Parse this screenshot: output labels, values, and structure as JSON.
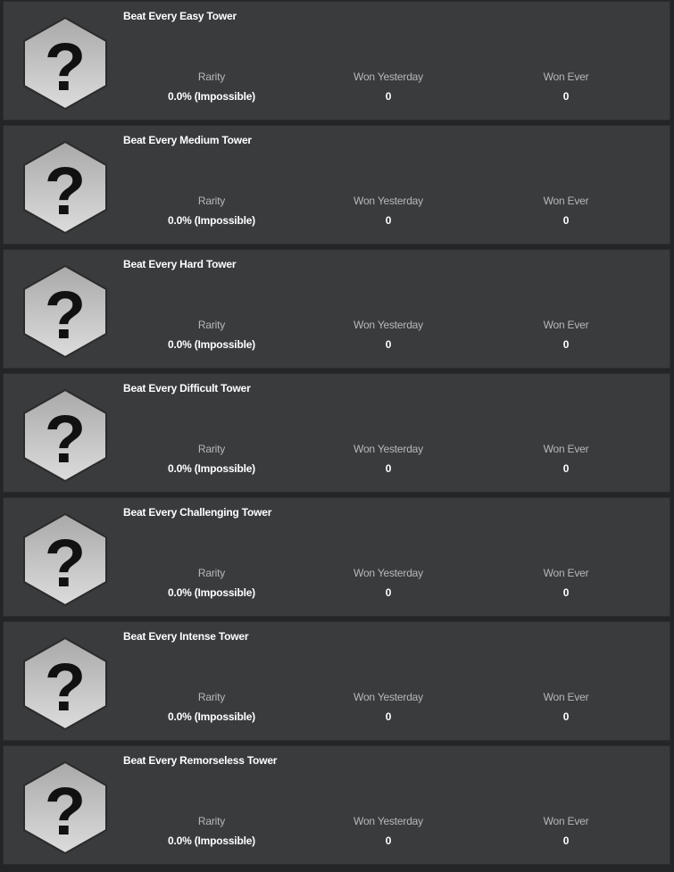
{
  "stat_labels": {
    "rarity": "Rarity",
    "won_yesterday": "Won Yesterday",
    "won_ever": "Won Ever"
  },
  "icon": "question-mark-hexagon-icon",
  "badges": [
    {
      "title": "Beat Every Easy Tower",
      "rarity": "0.0% (Impossible)",
      "won_yesterday": "0",
      "won_ever": "0"
    },
    {
      "title": "Beat Every Medium Tower",
      "rarity": "0.0% (Impossible)",
      "won_yesterday": "0",
      "won_ever": "0"
    },
    {
      "title": "Beat Every Hard Tower",
      "rarity": "0.0% (Impossible)",
      "won_yesterday": "0",
      "won_ever": "0"
    },
    {
      "title": "Beat Every Difficult Tower",
      "rarity": "0.0% (Impossible)",
      "won_yesterday": "0",
      "won_ever": "0"
    },
    {
      "title": "Beat Every Challenging Tower",
      "rarity": "0.0% (Impossible)",
      "won_yesterday": "0",
      "won_ever": "0"
    },
    {
      "title": "Beat Every Intense Tower",
      "rarity": "0.0% (Impossible)",
      "won_yesterday": "0",
      "won_ever": "0"
    },
    {
      "title": "Beat Every Remorseless Tower",
      "rarity": "0.0% (Impossible)",
      "won_yesterday": "0",
      "won_ever": "0"
    }
  ]
}
